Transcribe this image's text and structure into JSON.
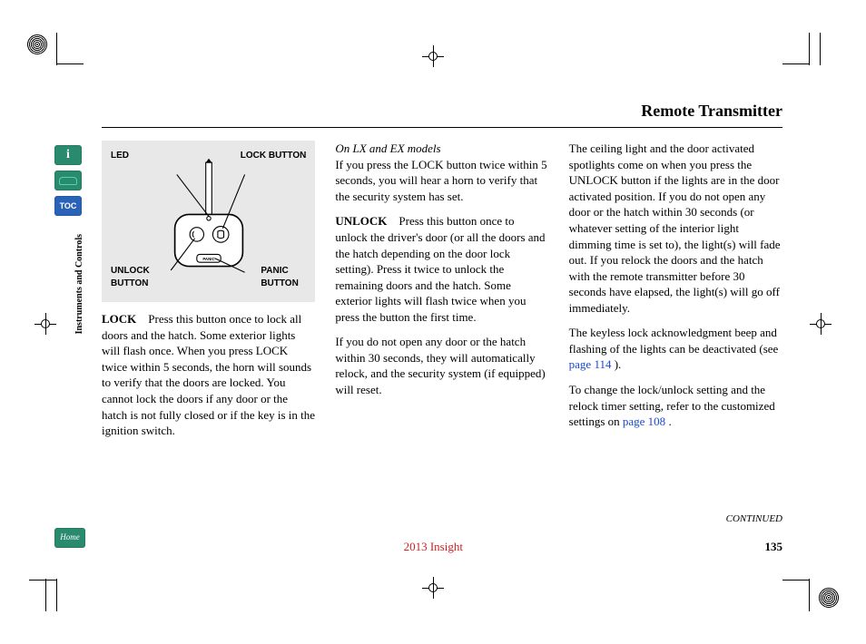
{
  "title": "Remote Transmitter",
  "section_tab": "Instruments and Controls",
  "nav": {
    "info": "i",
    "toc": "TOC",
    "home": "Home"
  },
  "diagram": {
    "led": "LED",
    "lock_button": "LOCK BUTTON",
    "unlock_button": "UNLOCK BUTTON",
    "panic_button": "PANIC BUTTON"
  },
  "col1": {
    "lock_label": "LOCK",
    "lock_text": "Press this button once to lock all doors and the hatch. Some exterior lights will flash once. When you press LOCK twice within 5 seconds, the horn will sounds to verify that the doors are locked. You cannot lock the doors if any door or the hatch is not fully closed or if the key is in the ignition switch."
  },
  "col2": {
    "models_note": "On LX and EX models",
    "p1": "If you press the LOCK button twice within 5 seconds, you will hear a horn to verify that the security system has set.",
    "unlock_label": "UNLOCK",
    "unlock_text": "Press this button once to unlock the driver's door (or all the doors and the hatch depending on the door lock setting). Press it twice to unlock the remaining doors and the hatch. Some exterior lights will flash twice when you press the button the first time.",
    "p3": "If you do not open any door or the hatch within 30 seconds, they will automatically relock, and the security system (if equipped) will reset."
  },
  "col3": {
    "p1": "The ceiling light and the door activated spotlights come on when you press the UNLOCK button if the lights are in the door activated position. If you do not open any door or the hatch within 30 seconds (or whatever setting of the interior light dimming time is set to), the light(s) will fade out. If you relock the doors and the hatch with the remote transmitter before 30 seconds have elapsed, the light(s) will go off immediately.",
    "p2a": "The keyless lock acknowledgment beep and flashing of the lights can be deactivated (see ",
    "p2_link": "page 114",
    "p2b": " ).",
    "p3a": "To change the lock/unlock setting and the relock timer setting, refer to the customized settings on ",
    "p3_link": "page 108",
    "p3b": " ."
  },
  "continued": "CONTINUED",
  "footer": {
    "model": "2013 Insight",
    "page": "135"
  }
}
